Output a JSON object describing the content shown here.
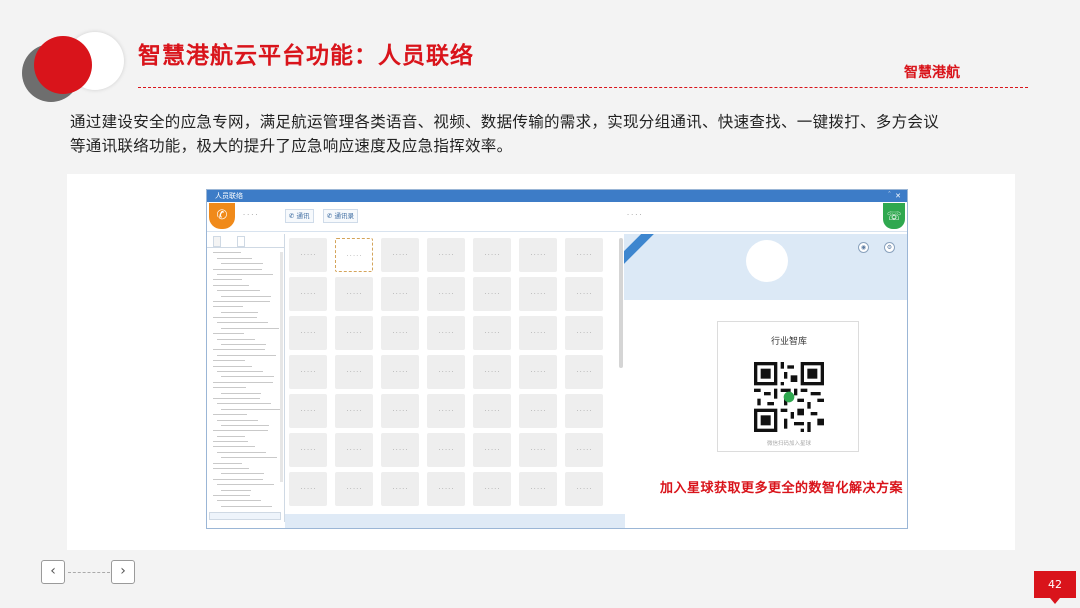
{
  "slide": {
    "title": "智慧港航云平台功能：人员联络",
    "brand": "智慧港航",
    "description": "通过建设安全的应急专网，满足航运管理各类语音、视频、数据传输的需求，实现分组通讯、快速查找、一键拨打、多方会议等通讯联络功能，极大的提升了应急响应速度及应急指挥效率。",
    "page_number": "42",
    "prev_icon": "chevron-left-icon",
    "next_icon": "chevron-right-icon"
  },
  "app": {
    "window_title": "人员联络",
    "toolbar_tabs": [
      "通讯",
      "通讯录"
    ]
  },
  "qr_card": {
    "title": "行业智库",
    "caption": "微信扫码加入星球"
  },
  "promo_text": "加入星球获取更多更全的数智化解决方案",
  "colors": {
    "accent": "#d9141b",
    "window_blue": "#3d7cc7",
    "call_orange": "#f08a1a",
    "call_green": "#2fa84f"
  }
}
